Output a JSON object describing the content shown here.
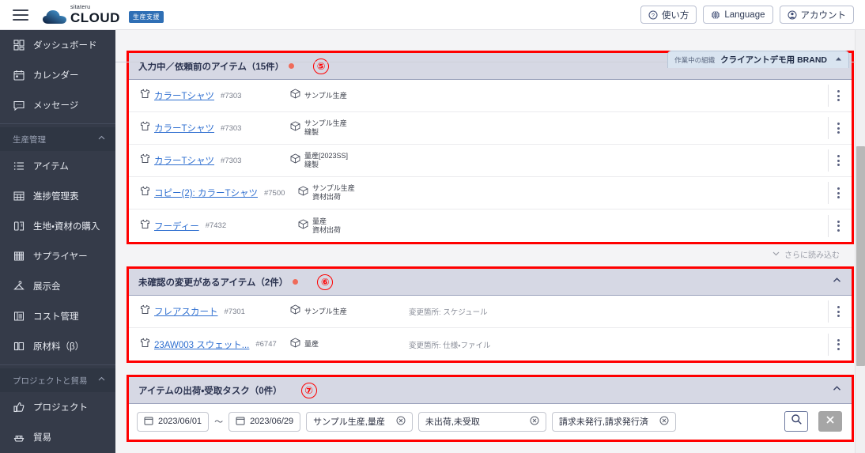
{
  "topbar": {
    "menu_icon": "hamburger-icon",
    "logo_sub": "sitateru",
    "logo_main": "CLOUD",
    "logo_badge": "生産支援",
    "buttons": [
      {
        "label": "使い方",
        "icon": "question-circle-icon"
      },
      {
        "label": "Language",
        "icon": "globe-icon"
      },
      {
        "label": "アカウント",
        "icon": "account-circle-icon"
      }
    ]
  },
  "org_tab": {
    "label": "作業中の組織",
    "name": "クライアントデモ用 BRAND",
    "chevron": "chevron-up-icon"
  },
  "sidebar": {
    "items": [
      {
        "label": "ダッシュボード",
        "icon": "dashboard-icon"
      },
      {
        "label": "カレンダー",
        "icon": "calendar-icon"
      },
      {
        "label": "メッセージ",
        "icon": "message-icon"
      }
    ],
    "group1": {
      "label": "生産管理",
      "chevron": "chevron-up-icon"
    },
    "group1_items": [
      {
        "label": "アイテム",
        "icon": "list-icon"
      },
      {
        "label": "進捗管理表",
        "icon": "table-icon"
      },
      {
        "label": "生地・資材の購入",
        "icon": "fabric-icon"
      },
      {
        "label": "サプライヤー",
        "icon": "building-icon"
      },
      {
        "label": "展示会",
        "icon": "hanger-icon"
      },
      {
        "label": "コスト管理",
        "icon": "cost-icon"
      },
      {
        "label": "原材料（β）",
        "icon": "material-icon"
      }
    ],
    "group2": {
      "label": "プロジェクトと貿易",
      "chevron": "chevron-up-icon"
    },
    "group2_items": [
      {
        "label": "プロジェクト",
        "icon": "thumbup-icon"
      },
      {
        "label": "貿易",
        "icon": "ship-icon"
      }
    ]
  },
  "panel5": {
    "title": "入力中／依頼前のアイテム（15件）",
    "badge_number": "⑤",
    "has_dot": true,
    "chevron": "chevron-up-icon",
    "rows": [
      {
        "name": "カラーTシャツ",
        "no": "#7303",
        "prod1": "サンプル生産",
        "prod2": ""
      },
      {
        "name": "カラーTシャツ",
        "no": "#7303",
        "prod1": "サンプル生産",
        "prod2": "縫製"
      },
      {
        "name": "カラーTシャツ",
        "no": "#7303",
        "prod1": "量産[2023SS]",
        "prod2": "縫製"
      },
      {
        "name": "コピー(2): カラーTシャツ",
        "no": "#7500",
        "prod1": "サンプル生産",
        "prod2": "資材出荷"
      },
      {
        "name": "フーディー",
        "no": "#7432",
        "prod1": "量産",
        "prod2": "資材出荷"
      }
    ],
    "load_more": "さらに読み込む"
  },
  "panel6": {
    "title": "未確認の変更があるアイテム（2件）",
    "badge_number": "⑥",
    "has_dot": true,
    "chevron": "chevron-up-icon",
    "rows": [
      {
        "name": "フレアスカート",
        "no": "#7301",
        "prod1": "サンプル生産",
        "prod2": "",
        "change": "変更箇所: スケジュール"
      },
      {
        "name": "23AW003 スウェット...",
        "no": "#6747",
        "prod1": "量産",
        "prod2": "",
        "change": "変更箇所: 仕様・ファイル"
      }
    ]
  },
  "panel7": {
    "title": "アイテムの出荷・受取タスク（0件）",
    "badge_number": "⑦",
    "has_dot": false,
    "chevron": "chevron-up-icon",
    "filters": {
      "date_from": "2023/06/01",
      "date_to": "2023/06/29",
      "tilde": "～",
      "chips": [
        "サンプル生産,量産",
        "未出荷,未受取",
        "請求未発行,請求発行済"
      ],
      "search_icon": "search-icon",
      "clear_icon": "close-icon"
    }
  },
  "colors": {
    "annotation_red": "#ff0000",
    "panel_head": "#d6d8e4",
    "sidebar": "#353b49",
    "link": "#2f6fd0",
    "dot": "#ef6b5a"
  }
}
